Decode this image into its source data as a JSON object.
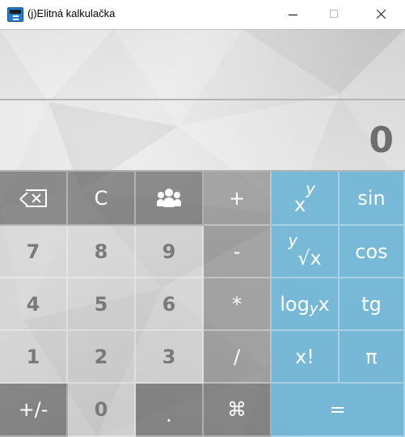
{
  "window": {
    "title": "(j)Elitná kalkulačka"
  },
  "display": {
    "history": "",
    "value": "0"
  },
  "keys": {
    "backspace": "",
    "clear": "C",
    "people": "",
    "plus": "+",
    "power_base": "x",
    "power_exp": "y",
    "sin": "sin",
    "seven": "7",
    "eight": "8",
    "nine": "9",
    "minus": "-",
    "root_index": "y",
    "root_body": "√x",
    "cos": "cos",
    "four": "4",
    "five": "5",
    "six": "6",
    "multiply": "*",
    "log_prefix": "log",
    "log_base": "y",
    "log_arg": "x",
    "tg": "tg",
    "one": "1",
    "two": "2",
    "three": "3",
    "divide": "/",
    "factorial": "x!",
    "pi": "π",
    "negate": "+/-",
    "zero": "0",
    "decimal": ".",
    "command": "⌘",
    "equals": "="
  },
  "icons": {
    "app": "calculator-icon",
    "backspace": "backspace-icon",
    "people": "people-icon",
    "minimize": "minimize-icon",
    "maximize": "maximize-icon",
    "close": "close-icon"
  },
  "colors": {
    "dark_key": "#505050",
    "light_key": "#c8c8c8",
    "blue_key": "#60b0d6",
    "display_text": "#6e6e6e"
  }
}
